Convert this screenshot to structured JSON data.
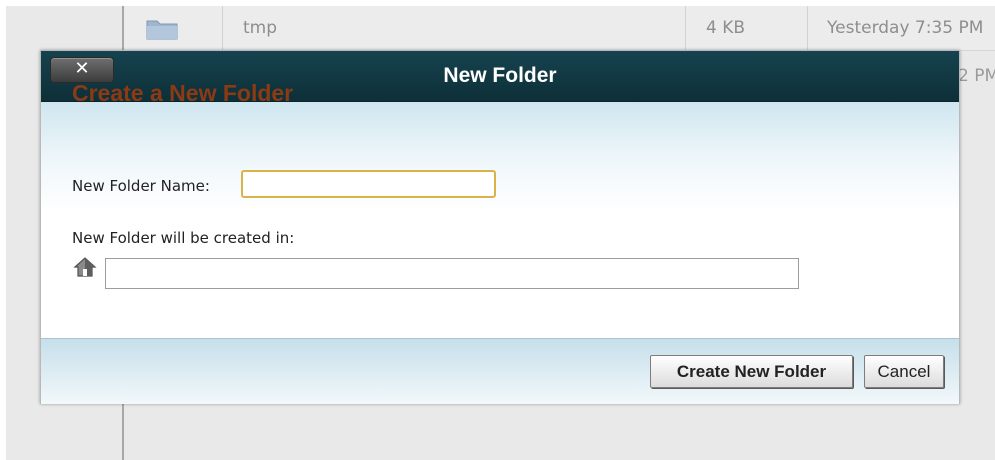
{
  "background": {
    "file_row": {
      "name": "tmp",
      "size": "4 KB",
      "modified": "Yesterday 7:35 PM",
      "icon": "folder-icon"
    },
    "partial_row_modified": "2 PM"
  },
  "dialog": {
    "title": "New Folder",
    "close_label": "✕",
    "heading": "Create a New Folder",
    "name_label": "New Folder Name:",
    "name_value": "",
    "location_label": "New Folder will be created in:",
    "location_icon": "home-icon",
    "location_value": "",
    "create_button": "Create New Folder",
    "cancel_button": "Cancel"
  },
  "colors": {
    "titlebar": "#0e2f38",
    "heading": "#8b3a14",
    "input_focus_border": "#d9b24a"
  }
}
